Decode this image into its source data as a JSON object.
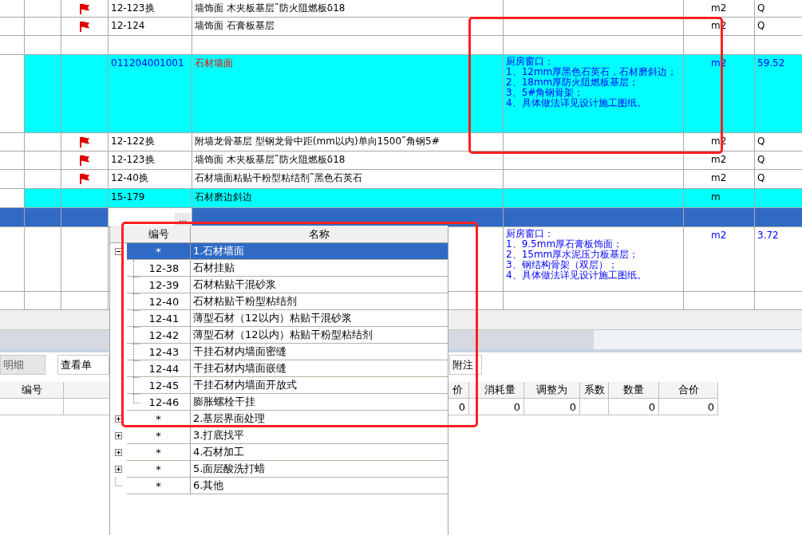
{
  "grid": {
    "rows": [
      {
        "kind": "item",
        "flag": true,
        "selected": false,
        "highlighted": false,
        "code": "12-123换",
        "name": "墙饰面 木夹板基层˜防火阻燃板δ18",
        "unit": "m2",
        "qty": "Q"
      },
      {
        "kind": "item",
        "flag": true,
        "selected": false,
        "highlighted": false,
        "code": "12-124",
        "name": "墙饰面 石膏板基层",
        "unit": "m2",
        "qty": "Q"
      },
      {
        "kind": "blank",
        "flag": false,
        "selected": false,
        "highlighted": false
      },
      {
        "kind": "bill",
        "flag": false,
        "selected": false,
        "highlighted": true,
        "code": "011204001001",
        "name": "石材墙面",
        "desc": [
          "厨房窗口：",
          "1、12mm厚黑色石英石，石材磨斜边；",
          "2、18mm厚防火阻燃板基层；",
          "3、5#角钢骨架；",
          "4、具体做法详见设计施工图纸。"
        ],
        "unit": "m2",
        "qty": "59.52"
      },
      {
        "kind": "item",
        "flag": true,
        "selected": false,
        "highlighted": false,
        "code": "12-122换",
        "name": "附墙龙骨基层 型钢龙骨中距(mm以内)单向1500˜角钢5#",
        "unit": "m2",
        "qty": "Q"
      },
      {
        "kind": "item",
        "flag": true,
        "selected": false,
        "highlighted": false,
        "code": "12-123换",
        "name": "墙饰面 木夹板基层˜防火阻燃板δ18",
        "unit": "m2",
        "qty": "Q"
      },
      {
        "kind": "item",
        "flag": true,
        "selected": false,
        "highlighted": false,
        "code": "12-40换",
        "name": "石材墙面粘贴干粉型粘结剂˜黑色石英石",
        "unit": "m2",
        "qty": "Q"
      },
      {
        "kind": "item",
        "flag": false,
        "selected": false,
        "highlighted": true,
        "code": "15-179",
        "name": "石材磨边斜边",
        "unit": "m"
      },
      {
        "kind": "editing",
        "flag": false,
        "selected": true,
        "picker_button": "..."
      },
      {
        "kind": "bill",
        "flag": false,
        "selected": false,
        "highlighted": false,
        "desc": [
          "厨房窗口：",
          "1、9.5mm厚石膏板饰面；",
          "2、15mm厚水泥压力板基层；",
          "3、钢结构骨架（双层）；",
          "4、具体做法详见设计施工图纸。"
        ],
        "unit": "m2",
        "qty": "3.72"
      },
      {
        "kind": "blank",
        "flag": false,
        "selected": false,
        "highlighted": false
      }
    ]
  },
  "bottom_panel": {
    "tabs": [
      {
        "label": "明细",
        "selected": true
      },
      {
        "label": "查看单",
        "selected": false
      },
      {
        "label": "附注",
        "selected": false
      }
    ],
    "columns": [
      {
        "label": "编号"
      },
      {
        "label": "价",
        "value": "0"
      },
      {
        "label": "消耗量",
        "value": "0"
      },
      {
        "label": "调整为",
        "value": "0"
      },
      {
        "label": "系数"
      },
      {
        "label": "数量",
        "value": "0"
      },
      {
        "label": "合价",
        "value": "0"
      }
    ]
  },
  "dropdown": {
    "columns": [
      "编号",
      "名称"
    ],
    "items": [
      {
        "kind": "group",
        "code": "*",
        "name": "1.石材墙面",
        "selected": true,
        "expanded": true,
        "children": [
          {
            "code": "12-38",
            "name": "石材挂贴",
            "selected": false
          },
          {
            "code": "12-39",
            "name": "石材粘贴干混砂浆",
            "selected": false
          },
          {
            "code": "12-40",
            "name": "石材粘贴干粉型粘结剂",
            "selected": false
          },
          {
            "code": "12-41",
            "name": "薄型石材（12以内）粘贴干混砂浆",
            "selected": false
          },
          {
            "code": "12-42",
            "name": "薄型石材（12以内）粘贴干粉型粘结剂",
            "selected": false
          },
          {
            "code": "12-43",
            "name": "干挂石材内墙面密缝",
            "selected": false
          },
          {
            "code": "12-44",
            "name": "干挂石材内墙面嵌缝",
            "selected": false
          },
          {
            "code": "12-45",
            "name": "干挂石材内墙面开放式",
            "selected": false
          },
          {
            "code": "12-46",
            "name": "膨胀螺栓干挂",
            "selected": false
          }
        ]
      },
      {
        "kind": "group",
        "code": "*",
        "name": "2.基层界面处理",
        "selected": false,
        "expanded": false
      },
      {
        "kind": "group",
        "code": "*",
        "name": "3.打底找平",
        "selected": false,
        "expanded": false
      },
      {
        "kind": "group",
        "code": "*",
        "name": "4.石材加工",
        "selected": false,
        "expanded": false
      },
      {
        "kind": "group",
        "code": "*",
        "name": "5.面层酸洗打蜡",
        "selected": false,
        "expanded": false
      },
      {
        "kind": "leaf",
        "code": "*",
        "name": "6.其他",
        "selected": false
      }
    ]
  }
}
